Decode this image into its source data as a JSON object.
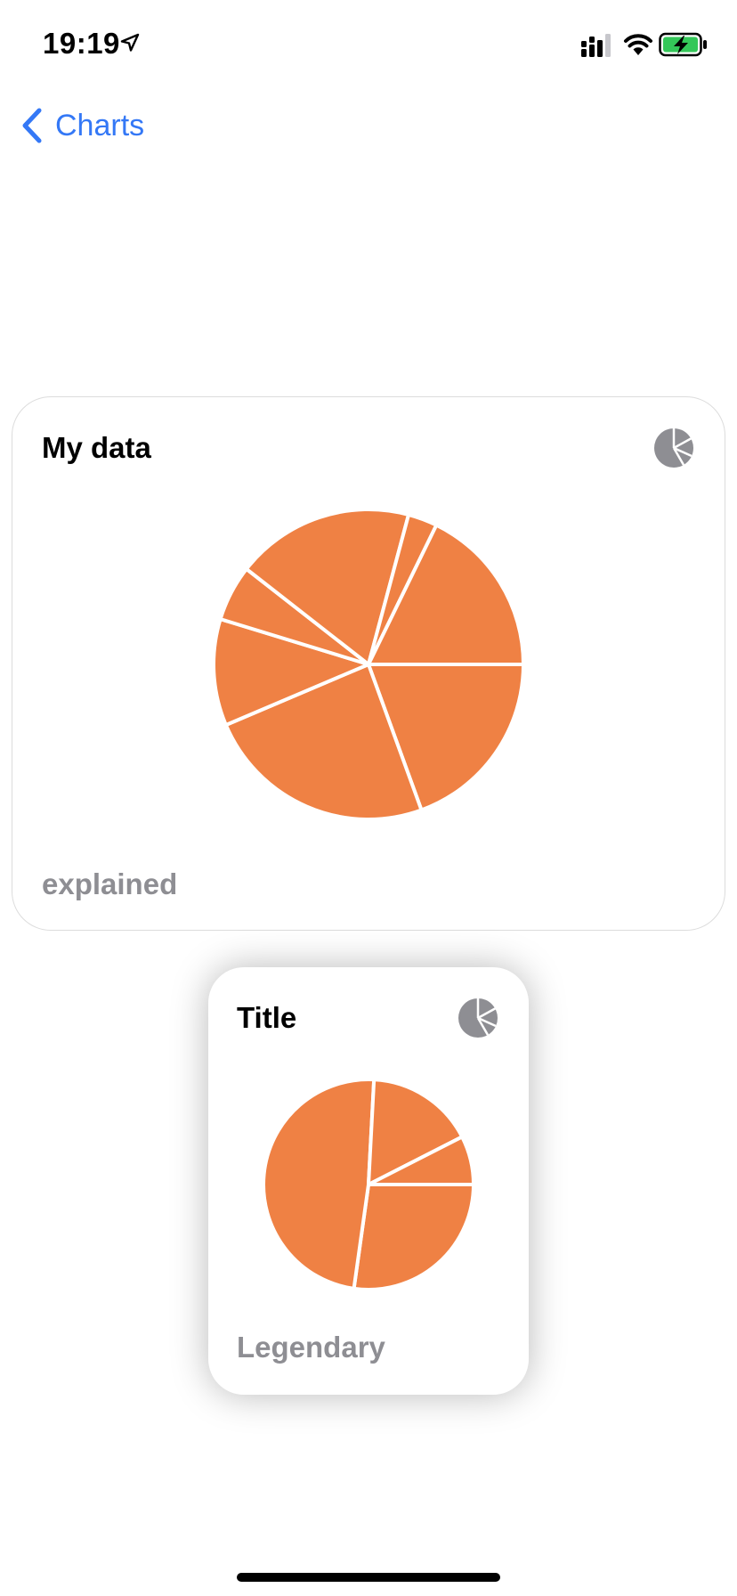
{
  "status_bar": {
    "time": "19:19",
    "battery_color": "#34c759"
  },
  "nav": {
    "back_label": "Charts",
    "accent_color": "#3478f6"
  },
  "cards": {
    "large": {
      "title": "My data",
      "subtitle": "explained",
      "icon": "pie-chart-icon"
    },
    "small": {
      "title": "Title",
      "subtitle": "Legendary",
      "icon": "pie-chart-icon"
    }
  },
  "chart_data": [
    {
      "type": "pie",
      "color": "#ef8144",
      "start_angle_deg": 0,
      "slice_angles_deg": [
        70,
        87,
        40,
        21,
        67,
        11,
        64
      ]
    },
    {
      "type": "pie",
      "color": "#ef8144",
      "start_angle_deg": 0,
      "slice_angles_deg": [
        98,
        175,
        60,
        27
      ]
    }
  ]
}
